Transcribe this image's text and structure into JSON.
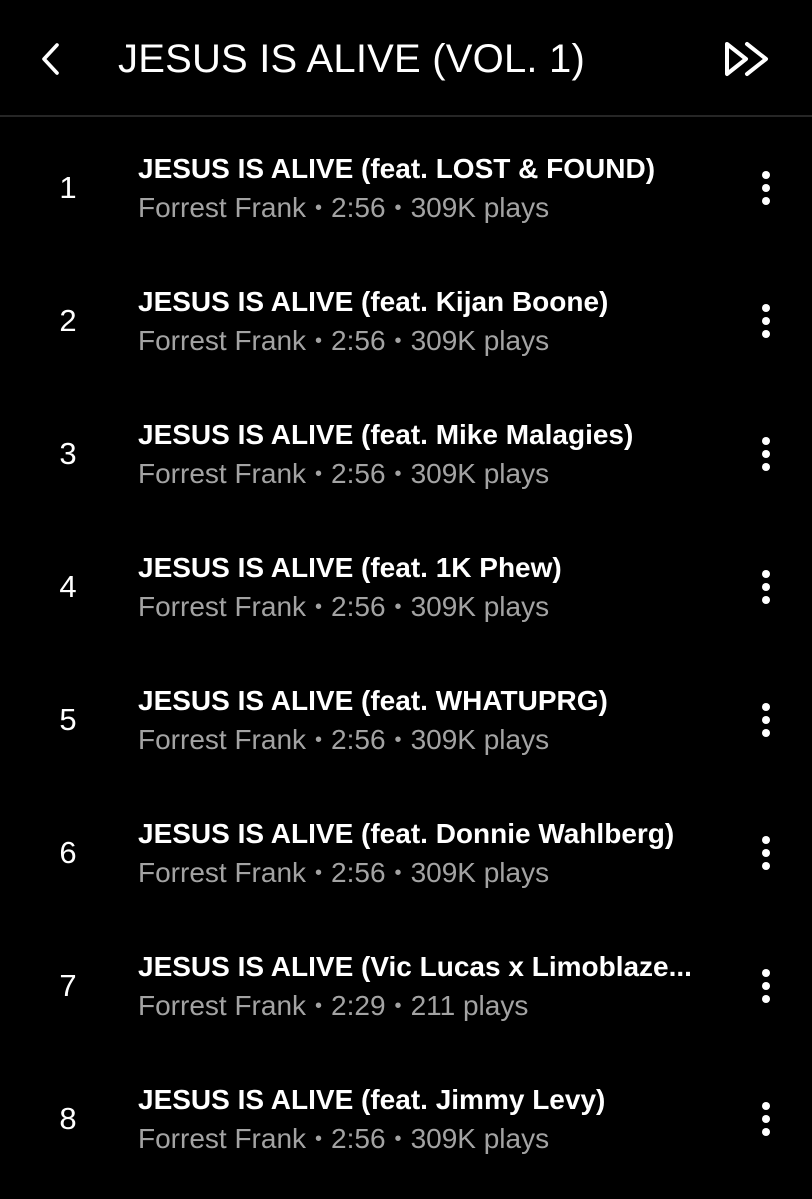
{
  "header": {
    "title": "JESUS IS ALIVE (VOL. 1)",
    "back_icon": "chevron-left-icon",
    "next_icon": "double-chevron-right-icon"
  },
  "tracks": [
    {
      "number": "1",
      "title": "JESUS IS ALIVE (feat. LOST & FOUND)",
      "artist": "Forrest Frank",
      "duration": "2:56",
      "plays": "309K plays"
    },
    {
      "number": "2",
      "title": "JESUS IS ALIVE (feat. Kijan Boone)",
      "artist": "Forrest Frank",
      "duration": "2:56",
      "plays": "309K plays"
    },
    {
      "number": "3",
      "title": "JESUS IS ALIVE (feat. Mike Malagies)",
      "artist": "Forrest Frank",
      "duration": "2:56",
      "plays": "309K plays"
    },
    {
      "number": "4",
      "title": "JESUS IS ALIVE (feat. 1K Phew)",
      "artist": "Forrest Frank",
      "duration": "2:56",
      "plays": "309K plays"
    },
    {
      "number": "5",
      "title": "JESUS IS ALIVE (feat. WHATUPRG)",
      "artist": "Forrest Frank",
      "duration": "2:56",
      "plays": "309K plays"
    },
    {
      "number": "6",
      "title": "JESUS IS ALIVE (feat. Donnie Wahlberg)",
      "artist": "Forrest Frank",
      "duration": "2:56",
      "plays": "309K plays"
    },
    {
      "number": "7",
      "title": "JESUS IS ALIVE (Vic Lucas x Limoblaze...",
      "artist": "Forrest Frank",
      "duration": "2:29",
      "plays": "211 plays"
    },
    {
      "number": "8",
      "title": "JESUS IS ALIVE (feat. Jimmy Levy)",
      "artist": "Forrest Frank",
      "duration": "2:56",
      "plays": "309K plays"
    }
  ],
  "separator": "•",
  "more_icon": "more-vertical-icon",
  "colors": {
    "background": "#000000",
    "text": "#ffffff",
    "secondary_text": "#a3a3a3",
    "divider": "#262626"
  }
}
